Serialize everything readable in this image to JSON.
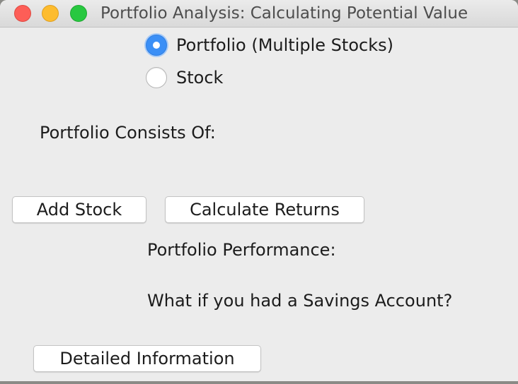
{
  "window": {
    "title": "Portfolio Analysis: Calculating Potential Value"
  },
  "mode_selector": {
    "options": [
      {
        "label": "Portfolio (Multiple Stocks)",
        "selected": true
      },
      {
        "label": "Stock",
        "selected": false
      }
    ]
  },
  "portfolio": {
    "consists_of_label": "Portfolio Consists Of:"
  },
  "actions": {
    "add_stock_label": "Add Stock",
    "calculate_returns_label": "Calculate Returns",
    "detailed_information_label": "Detailed Information"
  },
  "results": {
    "performance_label": "Portfolio Performance:",
    "savings_label": "What if you had a Savings Account?"
  },
  "colors": {
    "accent": "#3b8ff6",
    "window_background": "#ececec",
    "close": "#fd5e57",
    "minimize": "#fdbc2e",
    "zoom": "#28c840"
  }
}
